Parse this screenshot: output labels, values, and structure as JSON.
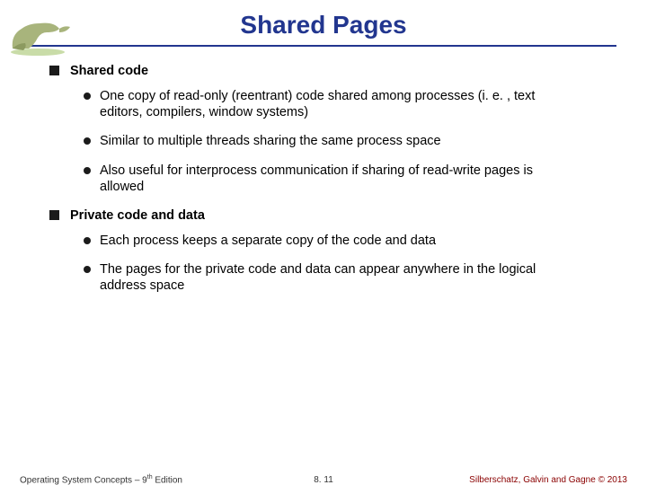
{
  "slide": {
    "title": "Shared Pages",
    "sections": [
      {
        "heading": "Shared code",
        "items": [
          "One copy of read-only (reentrant) code shared among processes (i. e. , text editors, compilers, window systems)",
          "Similar to multiple threads sharing the same process space",
          "Also useful for interprocess communication if sharing of read-write pages is allowed"
        ]
      },
      {
        "heading": "Private code and data",
        "items": [
          "Each process keeps a separate copy of the code and data",
          "The pages for the private code and data can appear anywhere in the logical address space"
        ]
      }
    ]
  },
  "footer": {
    "left_a": "Operating System Concepts – 9",
    "left_b": " Edition",
    "left_sup": "th",
    "center": "8. 11",
    "right_a": "Silberschatz, Galvin and Gagne ",
    "right_b": "2013",
    "copy": "©"
  },
  "logo_alt": "dinosaur-logo"
}
